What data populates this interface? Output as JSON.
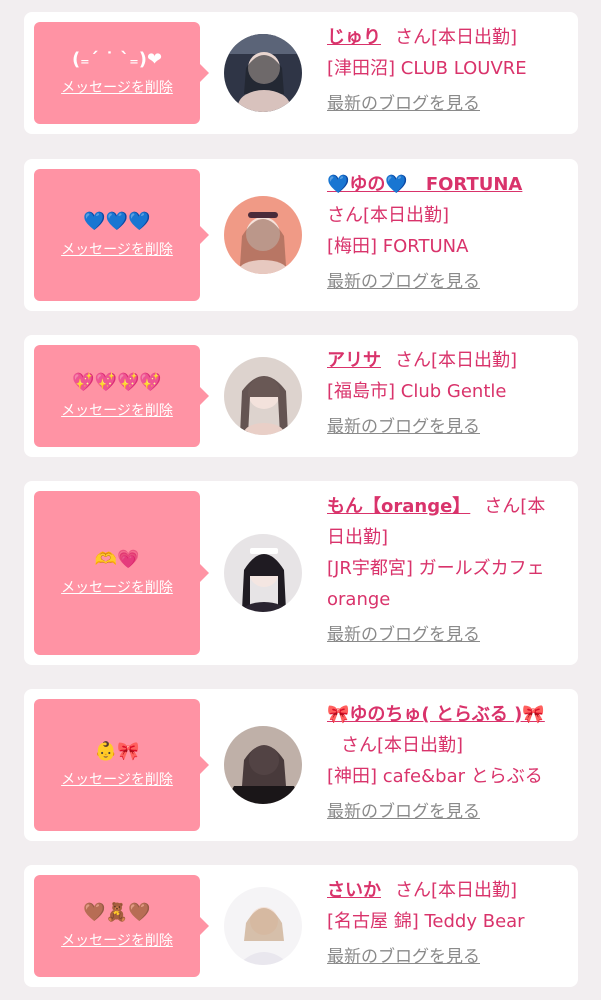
{
  "delete_label": "メッセージを削除",
  "san_label": "さん[本日出勤]",
  "blog_label": "最新のブログを見る",
  "cards": [
    {
      "message": "(₌ˊ ˙ ˋ₌)❤",
      "name": "じゅり",
      "shop": "[津田沼] CLUB LOUVRE"
    },
    {
      "message": "💙💙💙",
      "name": "💙ゆの💙　FORTUNA",
      "shop": "[梅田] FORTUNA"
    },
    {
      "message": "💖💖💖💖",
      "name": "アリサ",
      "shop": "[福島市] Club Gentle"
    },
    {
      "message": "🫶💗",
      "name": "もん【orange】",
      "shop": "[JR宇都宮] ガールズカフェ orange"
    },
    {
      "message": "👶🎀",
      "name": "🎀ゆのちゅ( とらぶる )🎀",
      "shop": "[神田] cafe&bar とらぶる"
    },
    {
      "message": "🤎🧸🤎",
      "name": "さいか",
      "shop": "[名古屋 錦] Teddy Bear"
    }
  ]
}
